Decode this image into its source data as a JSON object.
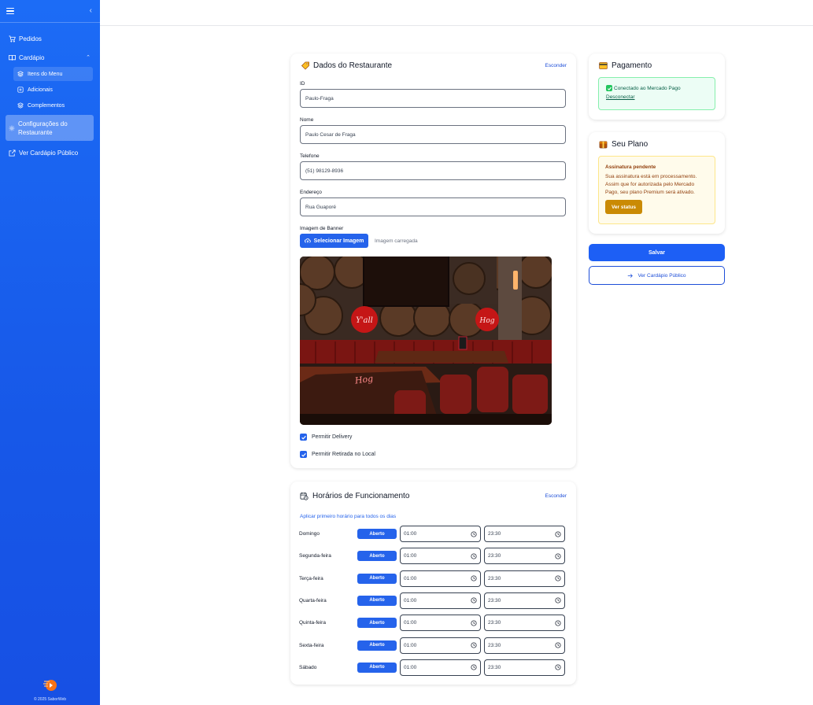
{
  "sidebar": {
    "nav": {
      "pedidos": "Pedidos",
      "cardapio": "Cardápio",
      "itens": "Itens do Menu",
      "adicionais": "Adicionais",
      "complementos": "Complementos",
      "config_line1": "Configurações do",
      "config_line2": "Restaurante",
      "publico": "Ver Cardápio Público"
    },
    "footer": "© 2025 SaborWeb"
  },
  "restaurant": {
    "title": "Dados do Restaurante",
    "hide": "Esconder",
    "fields": {
      "id_label": "ID",
      "id_value": "Paulo-Fraga",
      "nome_label": "Nome",
      "nome_value": "Paulo Cesar de Fraga",
      "tel_label": "Telefone",
      "tel_value": "(51) 98129-8936",
      "end_label": "Endereço",
      "end_value": "Rua Guaporé"
    },
    "banner_label": "Imagem de Banner",
    "select_image": "Selecionar Imagem",
    "image_status": "Imagem carregada",
    "banner": {
      "sign_left": "Y'all",
      "sign_right": "Hog",
      "sign_table": "Hog"
    },
    "delivery": "Permitir Delivery",
    "pickup": "Permitir Retirada no Local"
  },
  "hours": {
    "title": "Horários de Funcionamento",
    "hide": "Esconder",
    "apply_all": "Aplicar primeiro horário para todos os dias",
    "days": [
      {
        "day": "Domingo",
        "status": "Aberto",
        "open": "01:00",
        "close": "23:30"
      },
      {
        "day": "Segunda-feira",
        "status": "Aberto",
        "open": "01:00",
        "close": "23:30"
      },
      {
        "day": "Terça-feira",
        "status": "Aberto",
        "open": "01:00",
        "close": "23:30"
      },
      {
        "day": "Quarta-feira",
        "status": "Aberto",
        "open": "01:00",
        "close": "23:30"
      },
      {
        "day": "Quinta-feira",
        "status": "Aberto",
        "open": "01:00",
        "close": "23:30"
      },
      {
        "day": "Sexta-feira",
        "status": "Aberto",
        "open": "01:00",
        "close": "23:30"
      },
      {
        "day": "Sábado",
        "status": "Aberto",
        "open": "01:00",
        "close": "23:30"
      }
    ]
  },
  "payment": {
    "title": "Pagamento",
    "connected": "Conectado ao Mercado Pago",
    "disconnect": "Desconectar"
  },
  "plan": {
    "title": "Seu Plano",
    "pending_title": "Assinatura pendente",
    "pending_text": "Sua assinatura está em processamento. Assim que for autorizada pelo Mercado Pago, seu plano Premium será ativado.",
    "status_button": "Ver status"
  },
  "actions": {
    "save": "Salvar",
    "public_menu": "Ver Cardápio Público"
  },
  "colors": {
    "accent": "#2563eb",
    "sidebar": "#1c6cf6",
    "success_bg": "#ecfdf5",
    "warning_bg": "#fffbeb",
    "warning_btn": "#ca8a04"
  }
}
